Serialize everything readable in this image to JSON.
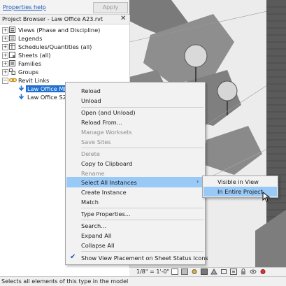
{
  "properties": {
    "help_label": "Properties help",
    "apply_label": "Apply"
  },
  "project_browser": {
    "title": "Project Browser - Law Office A23.rvt",
    "close_glyph": "✕",
    "items": [
      {
        "label": "Views (Phase and Discipline)",
        "expander": "+",
        "icon": "views-icon"
      },
      {
        "label": "Legends",
        "expander": "+",
        "icon": "legends-icon"
      },
      {
        "label": "Schedules/Quantities (all)",
        "expander": "+",
        "icon": "schedules-icon"
      },
      {
        "label": "Sheets (all)",
        "expander": "+",
        "icon": "sheets-icon"
      },
      {
        "label": "Families",
        "expander": "+",
        "icon": "families-icon"
      },
      {
        "label": "Groups",
        "expander": "+",
        "icon": "groups-icon"
      },
      {
        "label": "Revit Links",
        "expander": "−",
        "icon": "revit-links-icon"
      },
      {
        "label": "Law Office MEP23.rvt",
        "icon": "link-icon",
        "selected": true
      },
      {
        "label": "Law Office S23.rvt",
        "icon": "link-icon"
      }
    ]
  },
  "context_menu": {
    "items": [
      {
        "label": "Reload"
      },
      {
        "label": "Unload"
      },
      {
        "label": "Open (and Unload)"
      },
      {
        "label": "Reload From..."
      },
      {
        "label": "Manage Worksets",
        "disabled": true
      },
      {
        "label": "Save Sites",
        "disabled": true
      },
      {
        "label": "Delete",
        "disabled": true
      },
      {
        "label": "Copy to Clipboard"
      },
      {
        "label": "Rename",
        "disabled": true
      },
      {
        "label": "Select All Instances",
        "highlighted": true,
        "submenu_arrow": "›"
      },
      {
        "label": "Create Instance"
      },
      {
        "label": "Match"
      },
      {
        "label": "Type Properties..."
      },
      {
        "label": "Search..."
      },
      {
        "label": "Expand All"
      },
      {
        "label": "Collapse All"
      },
      {
        "label": "Show View Placement on Sheet Status Icons",
        "checked": true,
        "check_glyph": "✔"
      }
    ]
  },
  "submenu": {
    "items": [
      {
        "label": "Visible in View"
      },
      {
        "label": "In Entire Project",
        "highlighted": true
      }
    ]
  },
  "view_bar": {
    "scale": "1/8\" = 1'-0\""
  },
  "status_bar": {
    "text": "Selects all elements of this type in the model"
  },
  "colors": {
    "selection": "#1e6fd1",
    "menu_highlight": "#99c9f7",
    "link_blue": "#1a56b0"
  }
}
